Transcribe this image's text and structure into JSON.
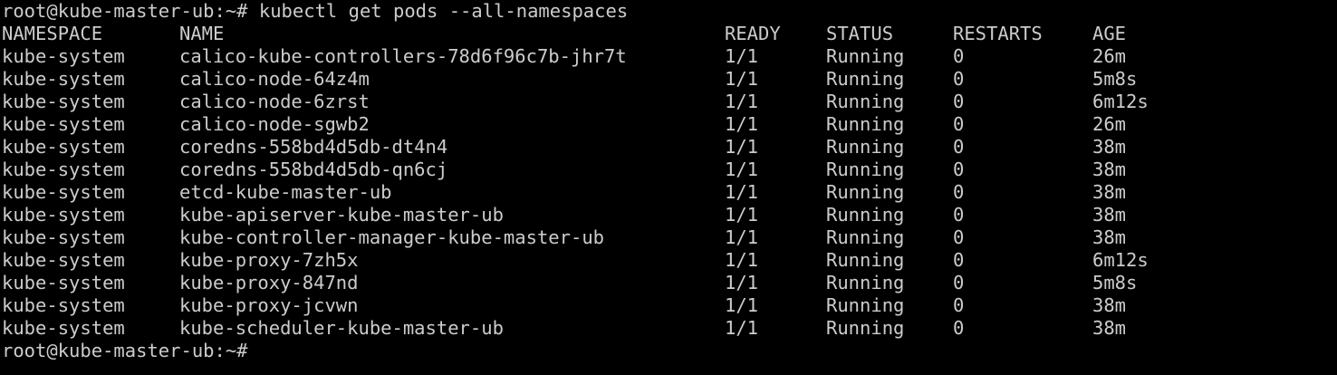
{
  "terminal": {
    "prompt": "root@kube-master-ub:~#",
    "command": " kubectl get pods --all-namespaces",
    "final_prompt": "root@kube-master-ub:~#",
    "headers": {
      "namespace": "NAMESPACE",
      "name": "NAME",
      "ready": "READY",
      "status": "STATUS",
      "restarts": "RESTARTS",
      "age": "AGE"
    },
    "rows": [
      {
        "namespace": "kube-system",
        "name": "calico-kube-controllers-78d6f96c7b-jhr7t",
        "ready": "1/1",
        "status": "Running",
        "restarts": "0",
        "age": "26m"
      },
      {
        "namespace": "kube-system",
        "name": "calico-node-64z4m",
        "ready": "1/1",
        "status": "Running",
        "restarts": "0",
        "age": "5m8s"
      },
      {
        "namespace": "kube-system",
        "name": "calico-node-6zrst",
        "ready": "1/1",
        "status": "Running",
        "restarts": "0",
        "age": "6m12s"
      },
      {
        "namespace": "kube-system",
        "name": "calico-node-sgwb2",
        "ready": "1/1",
        "status": "Running",
        "restarts": "0",
        "age": "26m"
      },
      {
        "namespace": "kube-system",
        "name": "coredns-558bd4d5db-dt4n4",
        "ready": "1/1",
        "status": "Running",
        "restarts": "0",
        "age": "38m"
      },
      {
        "namespace": "kube-system",
        "name": "coredns-558bd4d5db-qn6cj",
        "ready": "1/1",
        "status": "Running",
        "restarts": "0",
        "age": "38m"
      },
      {
        "namespace": "kube-system",
        "name": "etcd-kube-master-ub",
        "ready": "1/1",
        "status": "Running",
        "restarts": "0",
        "age": "38m"
      },
      {
        "namespace": "kube-system",
        "name": "kube-apiserver-kube-master-ub",
        "ready": "1/1",
        "status": "Running",
        "restarts": "0",
        "age": "38m"
      },
      {
        "namespace": "kube-system",
        "name": "kube-controller-manager-kube-master-ub",
        "ready": "1/1",
        "status": "Running",
        "restarts": "0",
        "age": "38m"
      },
      {
        "namespace": "kube-system",
        "name": "kube-proxy-7zh5x",
        "ready": "1/1",
        "status": "Running",
        "restarts": "0",
        "age": "6m12s"
      },
      {
        "namespace": "kube-system",
        "name": "kube-proxy-847nd",
        "ready": "1/1",
        "status": "Running",
        "restarts": "0",
        "age": "5m8s"
      },
      {
        "namespace": "kube-system",
        "name": "kube-proxy-jcvwn",
        "ready": "1/1",
        "status": "Running",
        "restarts": "0",
        "age": "38m"
      },
      {
        "namespace": "kube-system",
        "name": "kube-scheduler-kube-master-ub",
        "ready": "1/1",
        "status": "Running",
        "restarts": "0",
        "age": "38m"
      }
    ],
    "colors": {
      "background": "#000000",
      "foreground": "#cccccc"
    }
  }
}
